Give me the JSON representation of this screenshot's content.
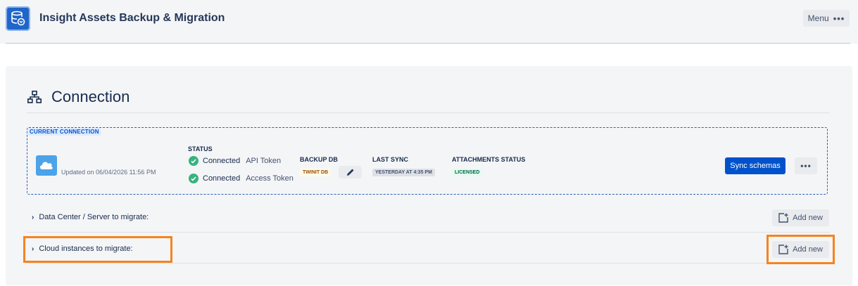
{
  "app": {
    "title": "Insight Assets Backup & Migration",
    "menu_label": "Menu"
  },
  "section": {
    "title": "Connection"
  },
  "current_connection": {
    "label": "CURRENT CONNECTION",
    "updated": "Updated on 06/04/2026 11:56 PM",
    "status_header": "STATUS",
    "status": [
      {
        "state": "Connected",
        "token": "API Token"
      },
      {
        "state": "Connected",
        "token": "Access Token"
      }
    ],
    "backup_db_header": "BACKUP DB",
    "backup_db_value": "TWINIT DB",
    "last_sync_header": "LAST SYNC",
    "last_sync_value": "YESTERDAY AT 4:35 PM",
    "attachments_header": "ATTACHMENTS STATUS",
    "attachments_value": "LICENSED",
    "sync_button": "Sync schemas"
  },
  "rows": [
    {
      "label": "Data Center / Server to migrate:",
      "add_label": "Add new"
    },
    {
      "label": "Cloud instances to migrate:",
      "add_label": "Add new"
    }
  ],
  "colors": {
    "primary": "#0052cc",
    "success": "#36b37e",
    "highlight": "#f5841f"
  },
  "icons": [
    "app-logo-icon",
    "hierarchy-icon",
    "cloud-icon",
    "check-circle-icon",
    "pencil-icon",
    "chevron-right-icon",
    "add-page-icon",
    "more-icon"
  ]
}
